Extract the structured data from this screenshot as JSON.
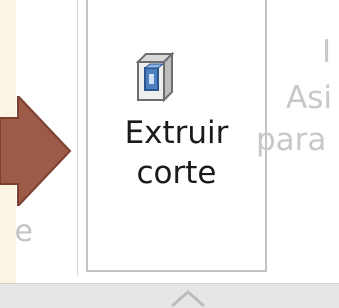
{
  "ribbon": {
    "prev_group_label_fragment": "ce",
    "extrude_cut": {
      "label_line1": "Extruir",
      "label_line2": "corte",
      "icon": "extrude-cut-icon"
    },
    "next_group": {
      "line1": "I",
      "line2": "Asi",
      "line3": "para"
    },
    "collapse_icon": "chevron-up-icon"
  },
  "colors": {
    "arrow_fill": "#9c5a48",
    "arrow_stroke": "#7a3f2f",
    "button_border": "#c2c2c2",
    "disabled_text": "#c8c8c8"
  }
}
